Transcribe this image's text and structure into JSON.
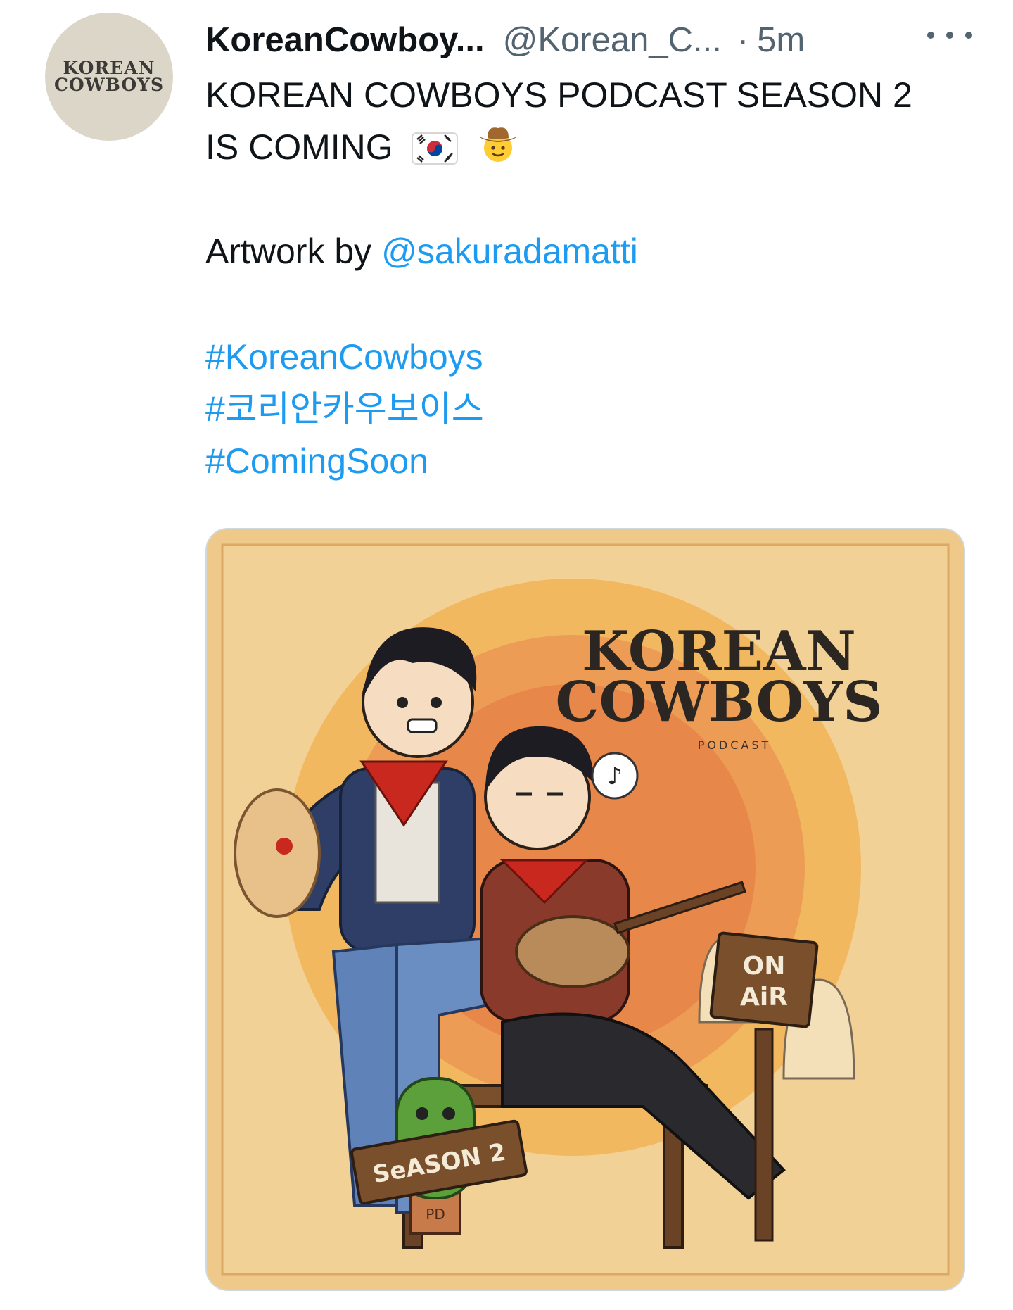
{
  "tweet": {
    "avatar": {
      "line1": "KOREAN",
      "line2": "COWBOYS"
    },
    "display_name": "KoreanCowboy...",
    "handle": "@Korean_C...",
    "separator": "·",
    "time": "5m",
    "more_icon": "more-horizontal-icon",
    "line1": "KOREAN COWBOYS PODCAST SEASON 2",
    "line2": "IS COMING",
    "emojis": [
      "south-korea-flag",
      "cowboy-face"
    ],
    "artwork_prefix": "Artwork by ",
    "artwork_mention": "@sakuradamatti",
    "hashtags": [
      "#KoreanCowboys",
      "#코리안카우보이스",
      "#ComingSoon"
    ]
  },
  "artwork": {
    "title_line1": "KOREAN",
    "title_line2": "COWBOYS",
    "subtitle": "PODCAST",
    "sign_on_air_1": "ON",
    "sign_on_air_2": "AiR",
    "sign_season": "SeASON 2",
    "pot_label": "PD",
    "colors": {
      "background": "#efc98a",
      "sun": "#e8874a",
      "ring": "#f2b860",
      "bandana": "#c8281e"
    }
  }
}
